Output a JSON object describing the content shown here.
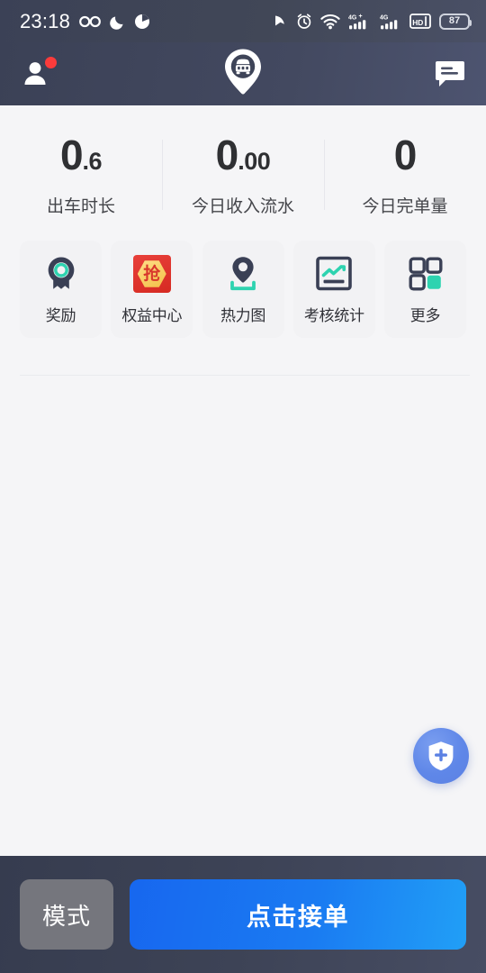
{
  "status_bar": {
    "time": "23:18",
    "battery_percent": "87",
    "icons": [
      "infinity-icon",
      "moon-icon",
      "do-not-disturb-icon",
      "location-cursor-icon",
      "alarm-clock-icon",
      "wifi-icon",
      "signal-4g-plus-icon",
      "signal-4g-icon",
      "hd-voice-icon",
      "battery-icon"
    ]
  },
  "header": {
    "profile_icon": "person-icon",
    "notification_badge": true,
    "logo_icon": "car-map-pin-logo",
    "message_icon": "chat-bubble-icon"
  },
  "stats": [
    {
      "int": "0",
      "dec": ".6",
      "label": "出车时长"
    },
    {
      "int": "0",
      "dec": ".00",
      "label": "今日收入流水"
    },
    {
      "int": "0",
      "dec": "",
      "label": "今日完单量"
    }
  ],
  "quick_actions": [
    {
      "label": "奖励",
      "icon": "medal-icon"
    },
    {
      "label": "权益中心",
      "icon": "grab-benefit-icon",
      "glyph": "抢"
    },
    {
      "label": "热力图",
      "icon": "heatmap-pin-icon"
    },
    {
      "label": "考核统计",
      "icon": "chart-stats-icon"
    },
    {
      "label": "更多",
      "icon": "grid-more-icon"
    }
  ],
  "fab": {
    "name": "safety-shield-button",
    "icon": "shield-plus-icon"
  },
  "bottom_bar": {
    "mode_label": "模式",
    "accept_label": "点击接单"
  },
  "colors": {
    "header_bg": "#3e4458",
    "page_bg": "#f5f5f7",
    "tile_bg": "#f2f2f4",
    "accent_teal": "#2ed3b0",
    "icon_navy": "#3a4055",
    "accept_blue": "#1a7bf2",
    "mode_gray": "#75767d",
    "badge_red": "#fb3b3b",
    "fab_blue": "#5f87e8"
  }
}
